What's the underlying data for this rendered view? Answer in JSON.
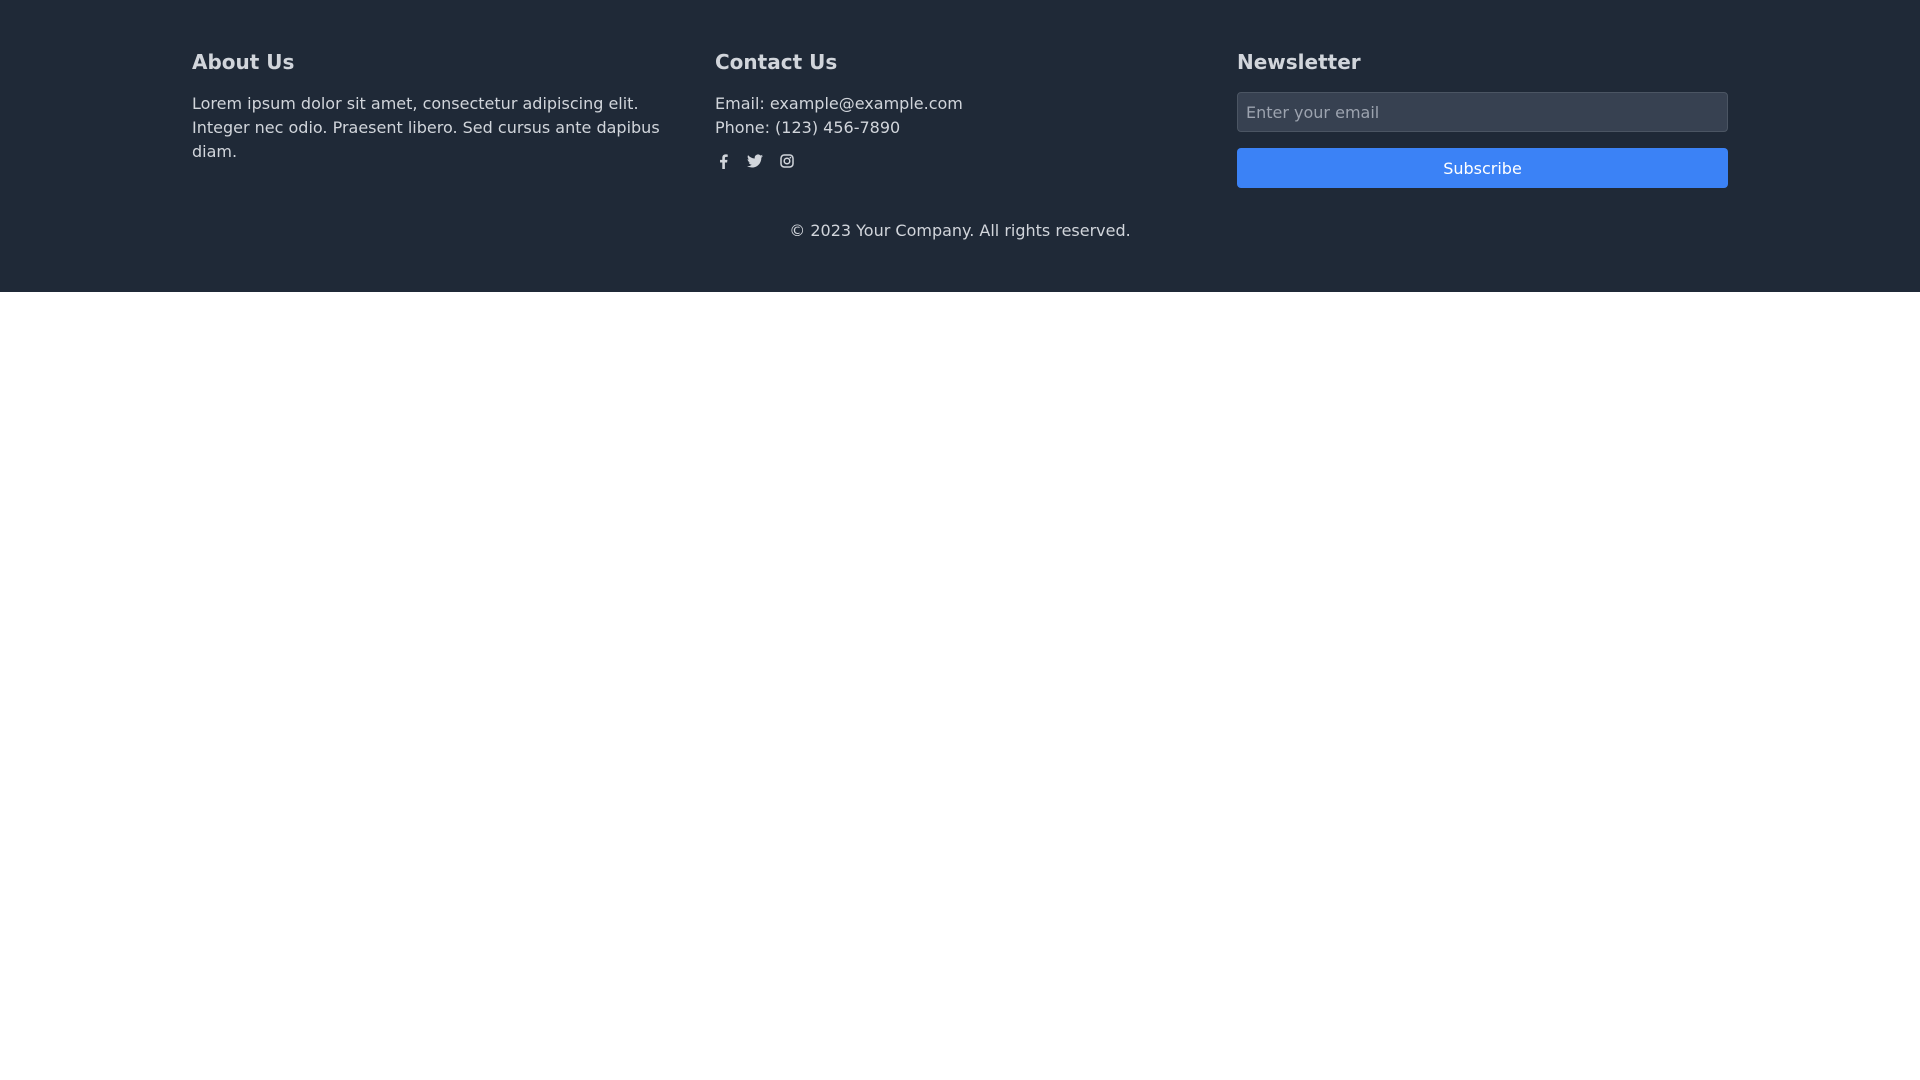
{
  "about": {
    "title": "About Us",
    "text": "Lorem ipsum dolor sit amet, consectetur adipiscing elit. Integer nec odio. Praesent libero. Sed cursus ante dapibus diam."
  },
  "contact": {
    "title": "Contact Us",
    "email": "Email: example@example.com",
    "phone": "Phone: (123) 456-7890",
    "social_icons": [
      "facebook-icon",
      "twitter-icon",
      "instagram-icon"
    ]
  },
  "newsletter": {
    "title": "Newsletter",
    "email_placeholder": "Enter your email",
    "email_value": "",
    "subscribe_label": "Subscribe"
  },
  "copyright": "© 2023 Your Company. All rights reserved.",
  "colors": {
    "footer_bg": "#1f2937",
    "text": "#d1d5db",
    "input_bg": "#374151",
    "button_bg": "#3b82f6",
    "page_bg": "#ffffff"
  }
}
